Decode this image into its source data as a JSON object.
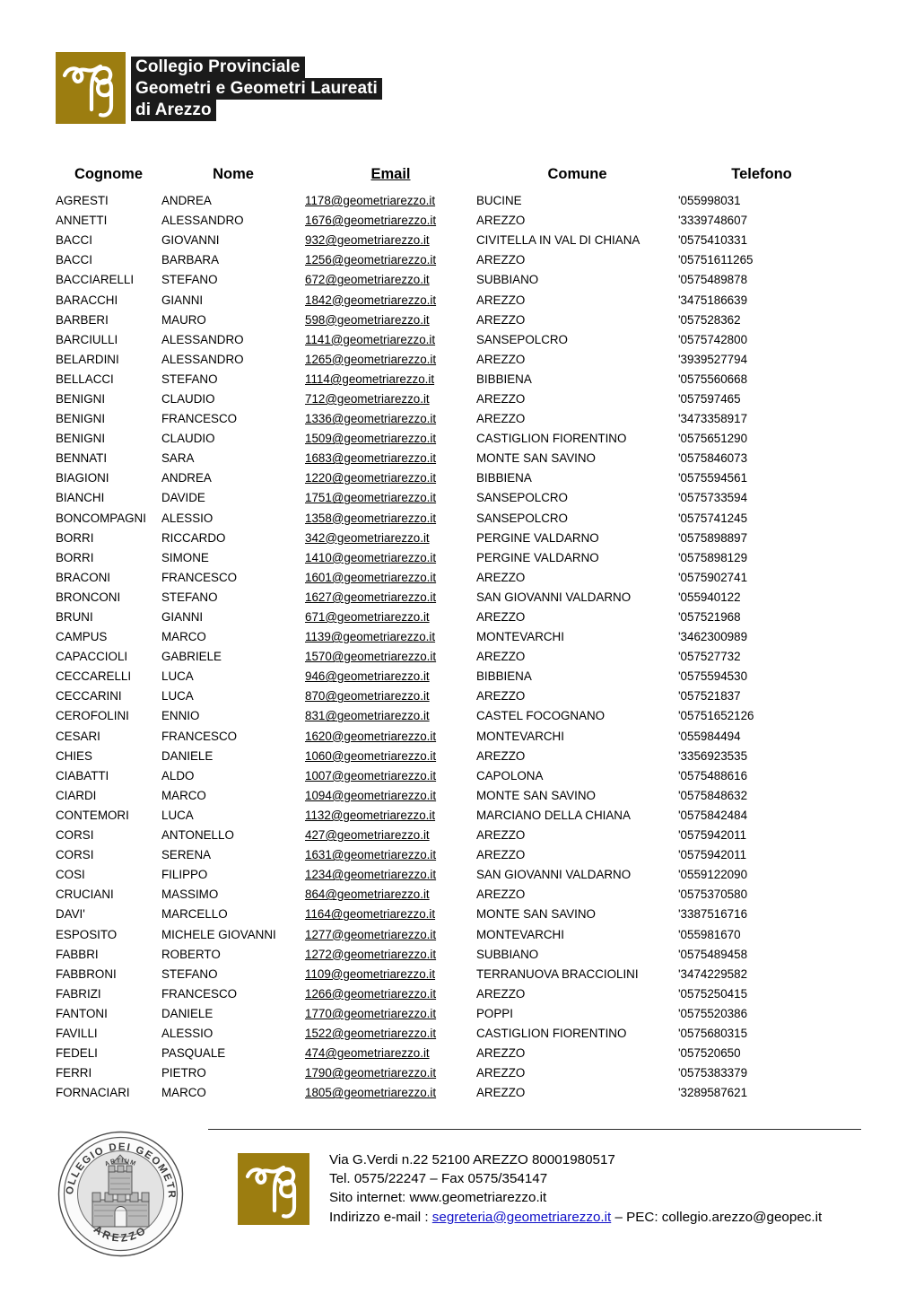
{
  "header": {
    "logo_mark_alt": "cpg-monogram",
    "logo_color": "#9c7d10",
    "title_line_1": "Collegio Provinciale",
    "title_line_2": "Geometri e Geometri Laureati",
    "title_line_3": "di Arezzo"
  },
  "table": {
    "columns": [
      "Cognome",
      "Nome",
      "Email",
      "Comune",
      "Telefono"
    ],
    "rows": [
      [
        "AGRESTI",
        "ANDREA",
        "1178@geometriarezzo.it",
        "BUCINE",
        "'055998031"
      ],
      [
        "ANNETTI",
        "ALESSANDRO",
        "1676@geometriarezzo.it",
        "AREZZO",
        "'3339748607"
      ],
      [
        "BACCI",
        "GIOVANNI",
        "932@geometriarezzo.it",
        "CIVITELLA IN VAL DI CHIANA",
        "'0575410331"
      ],
      [
        "BACCI",
        "BARBARA",
        "1256@geometriarezzo.it",
        "AREZZO",
        "'05751611265"
      ],
      [
        "BACCIARELLI",
        "STEFANO",
        "672@geometriarezzo.it",
        "SUBBIANO",
        "'0575489878"
      ],
      [
        "BARACCHI",
        "GIANNI",
        "1842@geometriarezzo.it",
        "AREZZO",
        "'3475186639"
      ],
      [
        "BARBERI",
        "MAURO",
        "598@geometriarezzo.it",
        "AREZZO",
        "'057528362"
      ],
      [
        "BARCIULLI",
        "ALESSANDRO",
        "1141@geometriarezzo.it",
        "SANSEPOLCRO",
        "'0575742800"
      ],
      [
        "BELARDINI",
        "ALESSANDRO",
        "1265@geometriarezzo.it",
        "AREZZO",
        "'3939527794"
      ],
      [
        "BELLACCI",
        "STEFANO",
        "1114@geometriarezzo.it",
        "BIBBIENA",
        "'0575560668"
      ],
      [
        "BENIGNI",
        "CLAUDIO",
        "712@geometriarezzo.it",
        "AREZZO",
        "'057597465"
      ],
      [
        "BENIGNI",
        "FRANCESCO",
        "1336@geometriarezzo.it",
        "AREZZO",
        "'3473358917"
      ],
      [
        "BENIGNI",
        "CLAUDIO",
        "1509@geometriarezzo.it",
        "CASTIGLION FIORENTINO",
        "'0575651290"
      ],
      [
        "BENNATI",
        "SARA",
        "1683@geometriarezzo.it",
        "MONTE SAN SAVINO",
        "'0575846073"
      ],
      [
        "BIAGIONI",
        "ANDREA",
        "1220@geometriarezzo.it",
        "BIBBIENA",
        "'0575594561"
      ],
      [
        "BIANCHI",
        "DAVIDE",
        "1751@geometriarezzo.it",
        "SANSEPOLCRO",
        "'0575733594"
      ],
      [
        "BONCOMPAGNI",
        "ALESSIO",
        "1358@geometriarezzo.it",
        "SANSEPOLCRO",
        "'0575741245"
      ],
      [
        "BORRI",
        "RICCARDO",
        "342@geometriarezzo.it",
        "PERGINE VALDARNO",
        "'0575898897"
      ],
      [
        "BORRI",
        "SIMONE",
        "1410@geometriarezzo.it",
        "PERGINE VALDARNO",
        "'0575898129"
      ],
      [
        "BRACONI",
        "FRANCESCO",
        "1601@geometriarezzo.it",
        "AREZZO",
        "'0575902741"
      ],
      [
        "BRONCONI",
        "STEFANO",
        "1627@geometriarezzo.it",
        "SAN GIOVANNI VALDARNO",
        "'055940122"
      ],
      [
        "BRUNI",
        "GIANNI",
        "671@geometriarezzo.it",
        "AREZZO",
        "'057521968"
      ],
      [
        "CAMPUS",
        "MARCO",
        "1139@geometriarezzo.it",
        "MONTEVARCHI",
        "'3462300989"
      ],
      [
        "CAPACCIOLI",
        "GABRIELE",
        "1570@geometriarezzo.it",
        "AREZZO",
        "'057527732"
      ],
      [
        "CECCARELLI",
        "LUCA",
        "946@geometriarezzo.it",
        "BIBBIENA",
        "'0575594530"
      ],
      [
        "CECCARINI",
        "LUCA",
        "870@geometriarezzo.it",
        "AREZZO",
        "'057521837"
      ],
      [
        "CEROFOLINI",
        "ENNIO",
        "831@geometriarezzo.it",
        "CASTEL FOCOGNANO",
        "'05751652126"
      ],
      [
        "CESARI",
        "FRANCESCO",
        "1620@geometriarezzo.it",
        "MONTEVARCHI",
        "'055984494"
      ],
      [
        "CHIES",
        "DANIELE",
        "1060@geometriarezzo.it",
        "AREZZO",
        "'3356923535"
      ],
      [
        "CIABATTI",
        "ALDO",
        "1007@geometriarezzo.it",
        "CAPOLONA",
        "'0575488616"
      ],
      [
        "CIARDI",
        "MARCO",
        "1094@geometriarezzo.it",
        "MONTE SAN SAVINO",
        "'0575848632"
      ],
      [
        "CONTEMORI",
        "LUCA",
        "1132@geometriarezzo.it",
        "MARCIANO DELLA CHIANA",
        "'0575842484"
      ],
      [
        "CORSI",
        "ANTONELLO",
        "427@geometriarezzo.it",
        "AREZZO",
        "'0575942011"
      ],
      [
        "CORSI",
        "SERENA",
        "1631@geometriarezzo.it",
        "AREZZO",
        "'0575942011"
      ],
      [
        "COSI",
        "FILIPPO",
        "1234@geometriarezzo.it",
        "SAN GIOVANNI VALDARNO",
        "'0559122090"
      ],
      [
        "CRUCIANI",
        "MASSIMO",
        "864@geometriarezzo.it",
        "AREZZO",
        "'0575370580"
      ],
      [
        "DAVI'",
        "MARCELLO",
        "1164@geometriarezzo.it",
        "MONTE SAN SAVINO",
        "'3387516716"
      ],
      [
        "ESPOSITO",
        "MICHELE GIOVANNI",
        "1277@geometriarezzo.it",
        "MONTEVARCHI",
        "'055981670"
      ],
      [
        "FABBRI",
        "ROBERTO",
        "1272@geometriarezzo.it",
        "SUBBIANO",
        "'0575489458"
      ],
      [
        "FABBRONI",
        "STEFANO",
        "1109@geometriarezzo.it",
        "TERRANUOVA BRACCIOLINI",
        "'3474229582"
      ],
      [
        "FABRIZI",
        "FRANCESCO",
        "1266@geometriarezzo.it",
        "AREZZO",
        "'0575250415"
      ],
      [
        "FANTONI",
        "DANIELE",
        "1770@geometriarezzo.it",
        "POPPI",
        "'0575520386"
      ],
      [
        "FAVILLI",
        "ALESSIO",
        "1522@geometriarezzo.it",
        "CASTIGLION FIORENTINO",
        "'0575680315"
      ],
      [
        "FEDELI",
        "PASQUALE",
        "474@geometriarezzo.it",
        "AREZZO",
        "'057520650"
      ],
      [
        "FERRI",
        "PIETRO",
        "1790@geometriarezzo.it",
        "AREZZO",
        "'0575383379"
      ],
      [
        "FORNACIARI",
        "MARCO",
        "1805@geometriarezzo.it",
        "AREZZO",
        "'3289587621"
      ]
    ]
  },
  "footer": {
    "seal_text_top": "COLLEGIO DEI GEOMETRI",
    "seal_text_inner": "ARTIUM",
    "seal_text_bottom": "AREZZO",
    "logo_mark_alt": "cpg-monogram",
    "address_line": "Via G.Verdi n.22 52100 AREZZO 80001980517",
    "phone_line": "Tel. 0575/22247  – Fax 0575/354147",
    "website_line": "Sito internet: www.geometriarezzo.it",
    "email_label": "Indirizzo e-mail : ",
    "email_link": "segreteria@geometriarezzo.it",
    "pec_text": " – PEC: collegio.arezzo@geopec.it",
    "link_color": "#1010c8"
  }
}
